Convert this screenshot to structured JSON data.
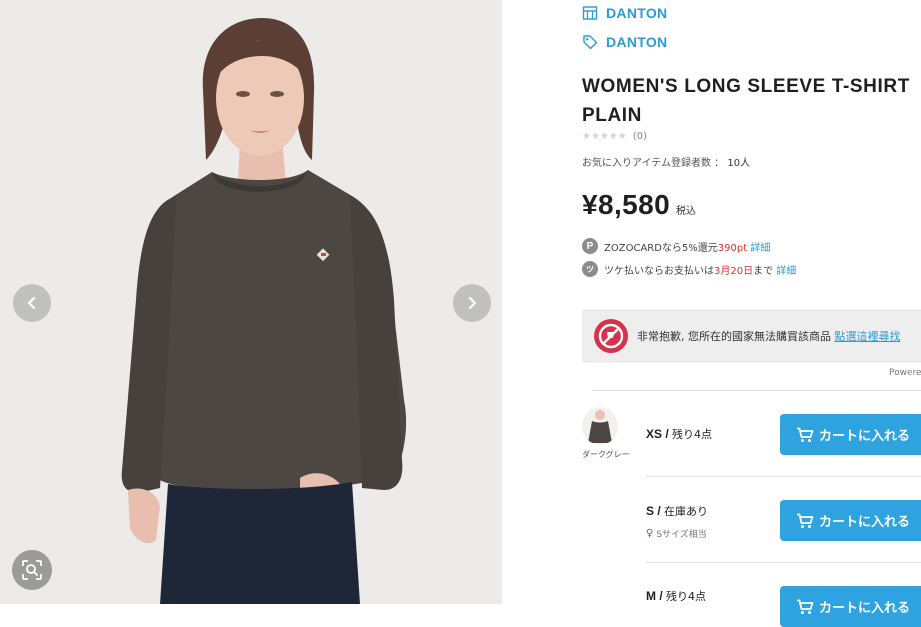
{
  "gallery": {
    "prev_icon": "chevron-left-icon",
    "next_icon": "chevron-right-icon",
    "zoom_icon": "zoom-search-icon"
  },
  "brand": {
    "shop_icon": "shop-icon",
    "shop_label": "DANTON",
    "tag_icon": "tag-icon",
    "brand_label": "DANTON",
    "accent_color": "#2a9bd6"
  },
  "product": {
    "title_line1": "WOMEN'S LONG SLEEVE T-SHIRT",
    "title_line2": "PLAIN",
    "stars": "★★★★★",
    "review_count": "(0)",
    "favorites_label": "お気に入りアイテム登録者数 ：",
    "favorites_count": "10人",
    "price": "¥8,580",
    "tax_label": "税込"
  },
  "promos": {
    "p1_badge": "P",
    "p1_text_a": "ZOZOCARDなら5%還元",
    "p1_points": "390pt",
    "p1_link": "詳細",
    "p2_text_a": "ツケ払いならお支払いは",
    "p2_date": "3月20日",
    "p2_text_b": "まで",
    "p2_link": "詳細"
  },
  "notice": {
    "text": "非常抱歉, 您所在的國家無法購買該商品",
    "link": "點選這裡尋找",
    "powered": "Powered"
  },
  "skus": [
    {
      "color_label": "ダークグレー",
      "size": "XS",
      "stock": "残り4点",
      "cart_label": "カートに入れる"
    },
    {
      "size": "S",
      "stock": "在庫あり",
      "fit_label": "Sサイズ相当",
      "cart_label": "カートに入れる"
    },
    {
      "size": "M",
      "stock": "残り4点",
      "cart_label": "カートに入れる"
    }
  ],
  "colors": {
    "cart_button": "#2ea3e0",
    "sale_red": "#d9332e"
  }
}
